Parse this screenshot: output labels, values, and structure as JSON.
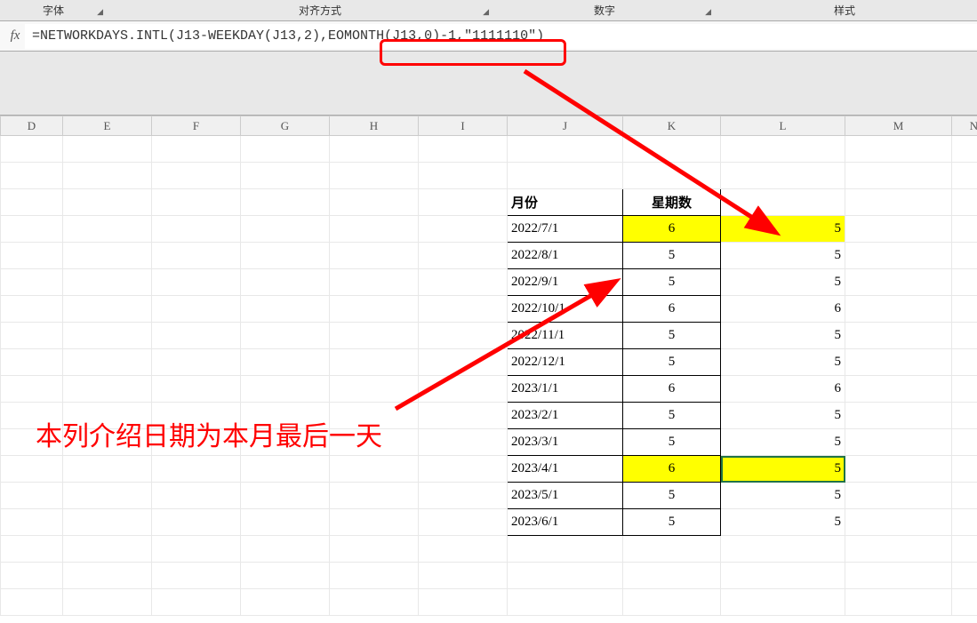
{
  "ribbon": {
    "group_font": "字体",
    "group_alignment": "对齐方式",
    "group_number": "数字",
    "group_styles": "样式"
  },
  "formula_bar": {
    "fx_symbol": "fx",
    "formula_text": "=NETWORKDAYS.INTL(J13-WEEKDAY(J13,2),EOMONTH(J13,0)-1,\"1111110\")"
  },
  "columns": [
    "D",
    "E",
    "F",
    "G",
    "H",
    "I",
    "J",
    "K",
    "L",
    "M",
    "N"
  ],
  "table": {
    "header_month": "月份",
    "header_weekday_count": "星期数",
    "rows": [
      {
        "month": "2022/7/1",
        "k": "6",
        "l": "5",
        "hl": true
      },
      {
        "month": "2022/8/1",
        "k": "5",
        "l": "5",
        "hl": false
      },
      {
        "month": "2022/9/1",
        "k": "5",
        "l": "5",
        "hl": false
      },
      {
        "month": "2022/10/1",
        "k": "6",
        "l": "6",
        "hl": false
      },
      {
        "month": "2022/11/1",
        "k": "5",
        "l": "5",
        "hl": false
      },
      {
        "month": "2022/12/1",
        "k": "5",
        "l": "5",
        "hl": false
      },
      {
        "month": "2023/1/1",
        "k": "6",
        "l": "6",
        "hl": false
      },
      {
        "month": "2023/2/1",
        "k": "5",
        "l": "5",
        "hl": false
      },
      {
        "month": "2023/3/1",
        "k": "5",
        "l": "5",
        "hl": false
      },
      {
        "month": "2023/4/1",
        "k": "6",
        "l": "5",
        "hl": true,
        "selected": true
      },
      {
        "month": "2023/5/1",
        "k": "5",
        "l": "5",
        "hl": false
      },
      {
        "month": "2023/6/1",
        "k": "5",
        "l": "5",
        "hl": false
      }
    ]
  },
  "annotation": {
    "text": "本列介绍日期为本月最后一天"
  }
}
